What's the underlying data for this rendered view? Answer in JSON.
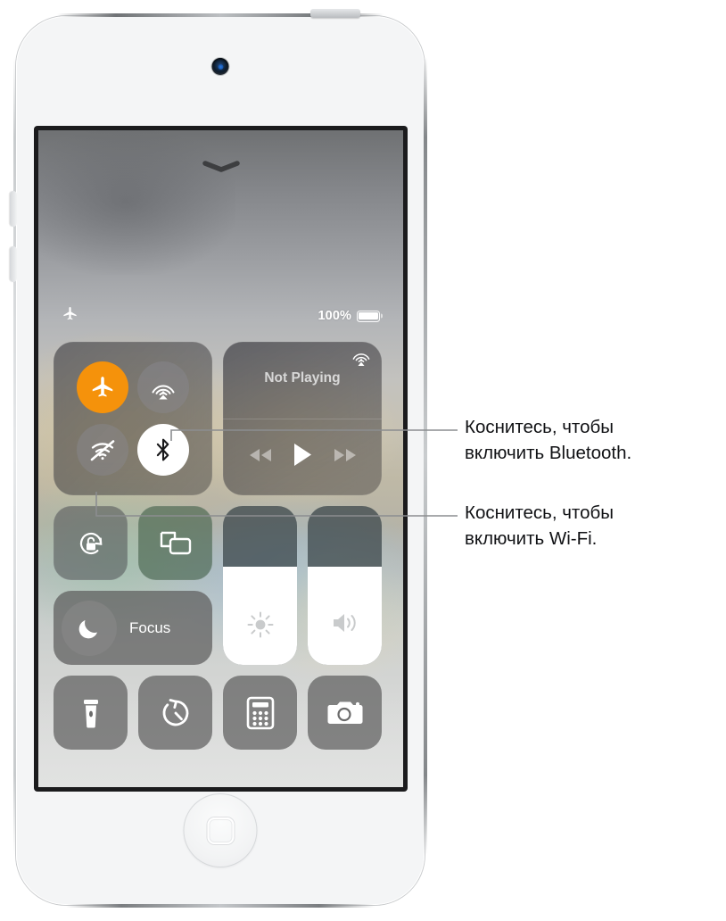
{
  "device": {
    "name": "ipod-touch",
    "color": "#f4f5f6",
    "camera": "front-camera",
    "home_button": "home-button"
  },
  "screen": {
    "grabber": "chevron-down-icon",
    "statusbar": {
      "airplane_icon": "airplane-icon",
      "battery_percent": "100%",
      "battery_icon": "battery-full-icon",
      "battery_level": 100
    }
  },
  "control_center": {
    "connectivity": {
      "airplane": {
        "icon": "airplane-icon",
        "state": "on",
        "color": "#f5920b"
      },
      "airdrop": {
        "icon": "airdrop-icon",
        "state": "off"
      },
      "wifi": {
        "icon": "wifi-off-icon",
        "state": "off"
      },
      "bluetooth": {
        "icon": "bluetooth-icon",
        "state": "on",
        "color": "#ffffff"
      }
    },
    "media": {
      "title": "Not Playing",
      "airplay_icon": "airplay-icon",
      "rewind_icon": "rewind-icon",
      "play_icon": "play-icon",
      "forward_icon": "fast-forward-icon"
    },
    "rotation_lock": {
      "icon": "rotation-lock-icon",
      "state": "off"
    },
    "screen_mirroring": {
      "icon": "screen-mirroring-icon",
      "state": "off"
    },
    "focus": {
      "label": "Focus",
      "icon": "moon-icon",
      "state": "off"
    },
    "brightness": {
      "icon": "brightness-icon",
      "value": 62
    },
    "volume": {
      "icon": "volume-icon",
      "value": 62
    },
    "shortcuts": [
      {
        "name": "flashlight",
        "icon": "flashlight-icon"
      },
      {
        "name": "timer",
        "icon": "timer-icon"
      },
      {
        "name": "calculator",
        "icon": "calculator-icon"
      },
      {
        "name": "camera",
        "icon": "camera-icon"
      }
    ]
  },
  "callouts": [
    {
      "id": "bluetooth-callout",
      "text": "Коснитесь, чтобы\nвключить Bluetooth."
    },
    {
      "id": "wifi-callout",
      "text": "Коснитесь, чтобы\nвключить Wi-Fi."
    }
  ]
}
